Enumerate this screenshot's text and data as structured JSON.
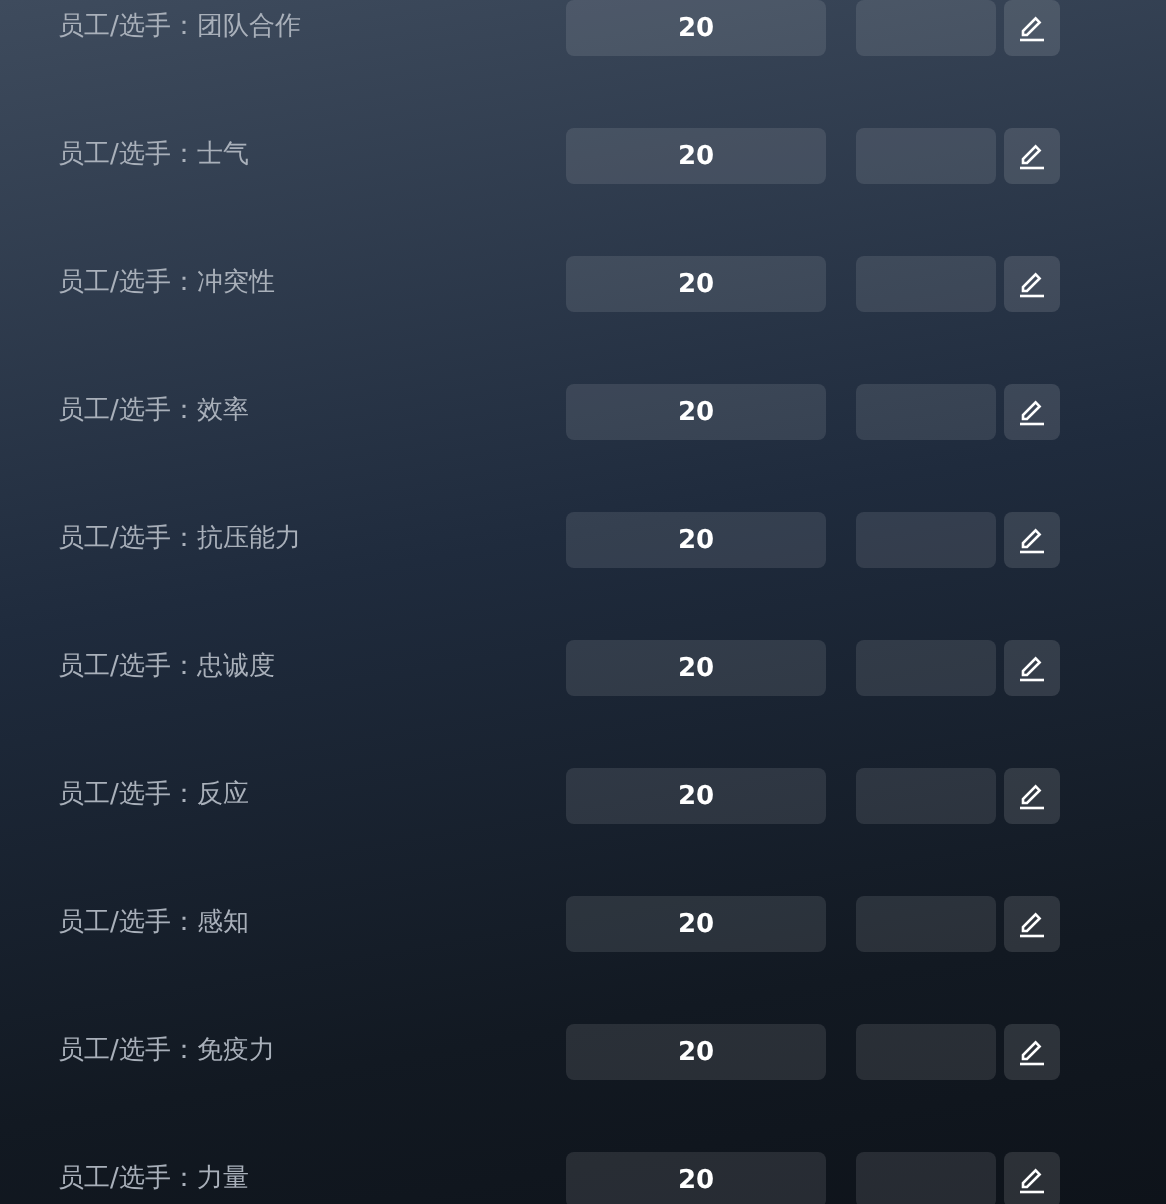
{
  "rows": [
    {
      "label": "员工/选手：团队合作",
      "value": "20"
    },
    {
      "label": "员工/选手：士气",
      "value": "20"
    },
    {
      "label": "员工/选手：冲突性",
      "value": "20"
    },
    {
      "label": "员工/选手：效率",
      "value": "20"
    },
    {
      "label": "员工/选手：抗压能力",
      "value": "20"
    },
    {
      "label": "员工/选手：忠诚度",
      "value": "20"
    },
    {
      "label": "员工/选手：反应",
      "value": "20"
    },
    {
      "label": "员工/选手：感知",
      "value": "20"
    },
    {
      "label": "员工/选手：免疫力",
      "value": "20"
    },
    {
      "label": "员工/选手：力量",
      "value": "20"
    }
  ]
}
